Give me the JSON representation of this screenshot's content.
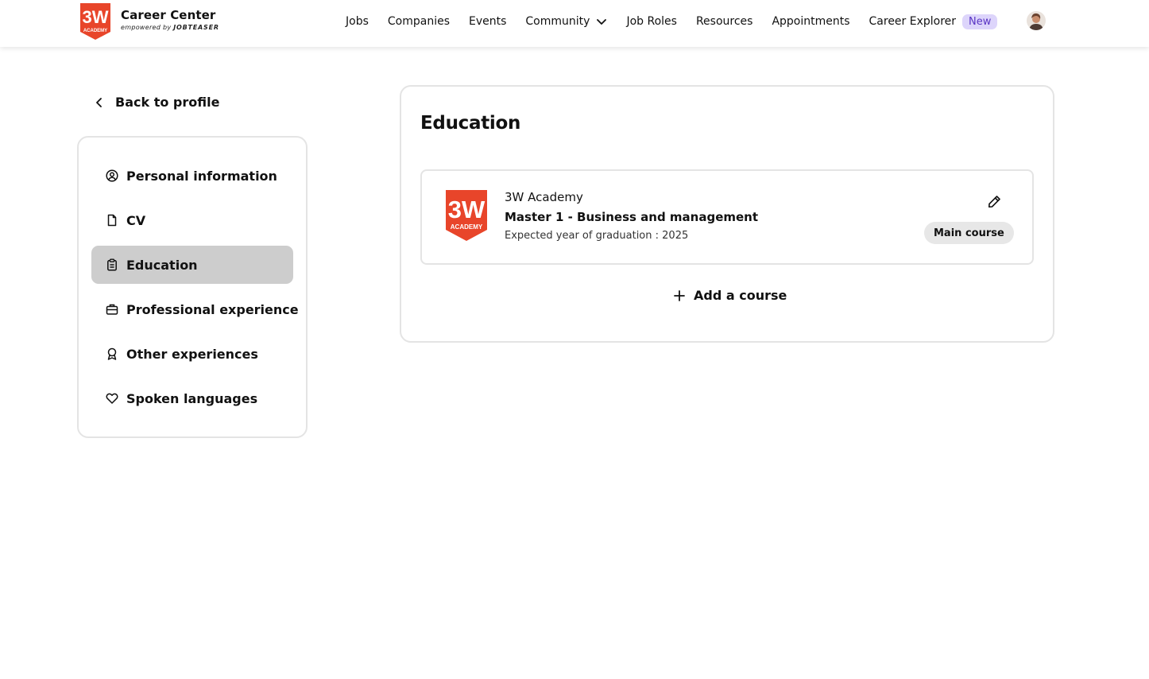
{
  "brand": {
    "title": "Career Center",
    "sub_prefix": "empowered by",
    "sub_brand": "JOBTEASER",
    "logo_text_top": "3W",
    "logo_text_bottom": "ACADEMY",
    "logo_color": "#e8452a"
  },
  "nav": {
    "items": [
      "Jobs",
      "Companies",
      "Events",
      "Community",
      "Job Roles",
      "Resources",
      "Appointments",
      "Career Explorer"
    ],
    "new_badge": "New"
  },
  "sidebar": {
    "back_label": "Back to profile",
    "items": [
      {
        "label": "Personal information",
        "icon": "user-circle-icon"
      },
      {
        "label": "CV",
        "icon": "file-icon"
      },
      {
        "label": "Education",
        "icon": "clipboard-icon",
        "active": true
      },
      {
        "label": "Professional experience",
        "icon": "briefcase-icon"
      },
      {
        "label": "Other experiences",
        "icon": "award-icon"
      },
      {
        "label": "Spoken languages",
        "icon": "heart-icon"
      }
    ]
  },
  "main": {
    "title": "Education",
    "course": {
      "school": "3W Academy",
      "degree": "Master 1 - Business and management",
      "graduation": "Expected year of graduation : 2025",
      "badge": "Main course"
    },
    "add_label": "Add a course"
  },
  "colors": {
    "active_bg": "#cdcdcd",
    "border": "#e4e4e4",
    "new_badge_bg": "#ddd5fb",
    "new_badge_text": "#5a35c4"
  }
}
